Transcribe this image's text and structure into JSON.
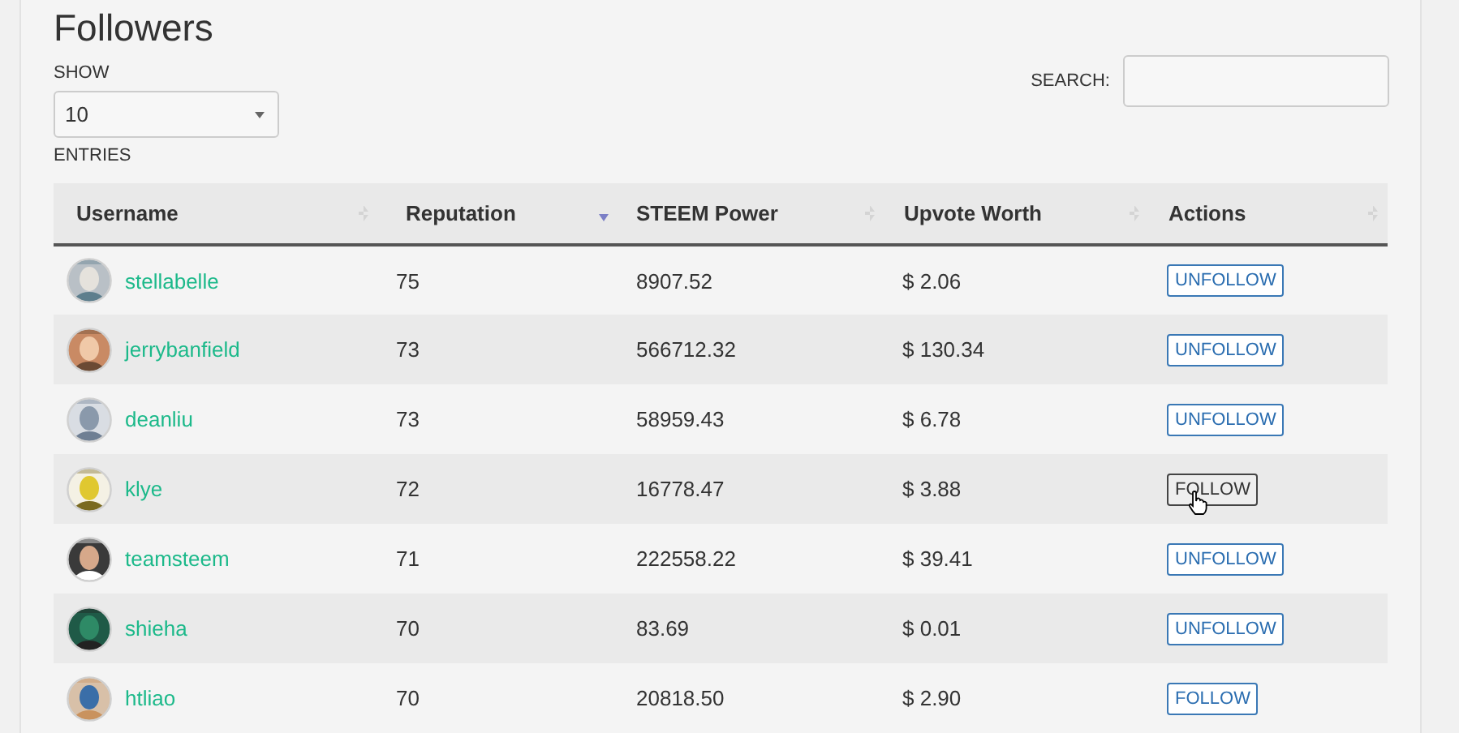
{
  "title": "Followers",
  "length_control": {
    "label_before": "SHOW",
    "value": "10",
    "label_after": "ENTRIES"
  },
  "search": {
    "label": "SEARCH:"
  },
  "table": {
    "columns": [
      {
        "label": "Username",
        "sorted_descending": false
      },
      {
        "label": "Reputation",
        "sorted_descending": true
      },
      {
        "label": "STEEM Power",
        "sorted_descending": false
      },
      {
        "label": "Upvote Worth",
        "sorted_descending": false
      },
      {
        "label": "Actions",
        "sorted_descending": false
      }
    ],
    "rows": [
      {
        "username": "stellabelle",
        "reputation": "75",
        "steem_power": "8907.52",
        "upvote_worth": "$ 2.06",
        "action": "UNFOLLOW",
        "hovered": false
      },
      {
        "username": "jerrybanfield",
        "reputation": "73",
        "steem_power": "566712.32",
        "upvote_worth": "$ 130.34",
        "action": "UNFOLLOW",
        "hovered": false
      },
      {
        "username": "deanliu",
        "reputation": "73",
        "steem_power": "58959.43",
        "upvote_worth": "$ 6.78",
        "action": "UNFOLLOW",
        "hovered": false
      },
      {
        "username": "klye",
        "reputation": "72",
        "steem_power": "16778.47",
        "upvote_worth": "$ 3.88",
        "action": "FOLLOW",
        "hovered": true
      },
      {
        "username": "teamsteem",
        "reputation": "71",
        "steem_power": "222558.22",
        "upvote_worth": "$ 39.41",
        "action": "UNFOLLOW",
        "hovered": false
      },
      {
        "username": "shieha",
        "reputation": "70",
        "steem_power": "83.69",
        "upvote_worth": "$ 0.01",
        "action": "UNFOLLOW",
        "hovered": false
      },
      {
        "username": "htliao",
        "reputation": "70",
        "steem_power": "20818.50",
        "upvote_worth": "$ 2.90",
        "action": "FOLLOW",
        "hovered": false
      }
    ]
  }
}
